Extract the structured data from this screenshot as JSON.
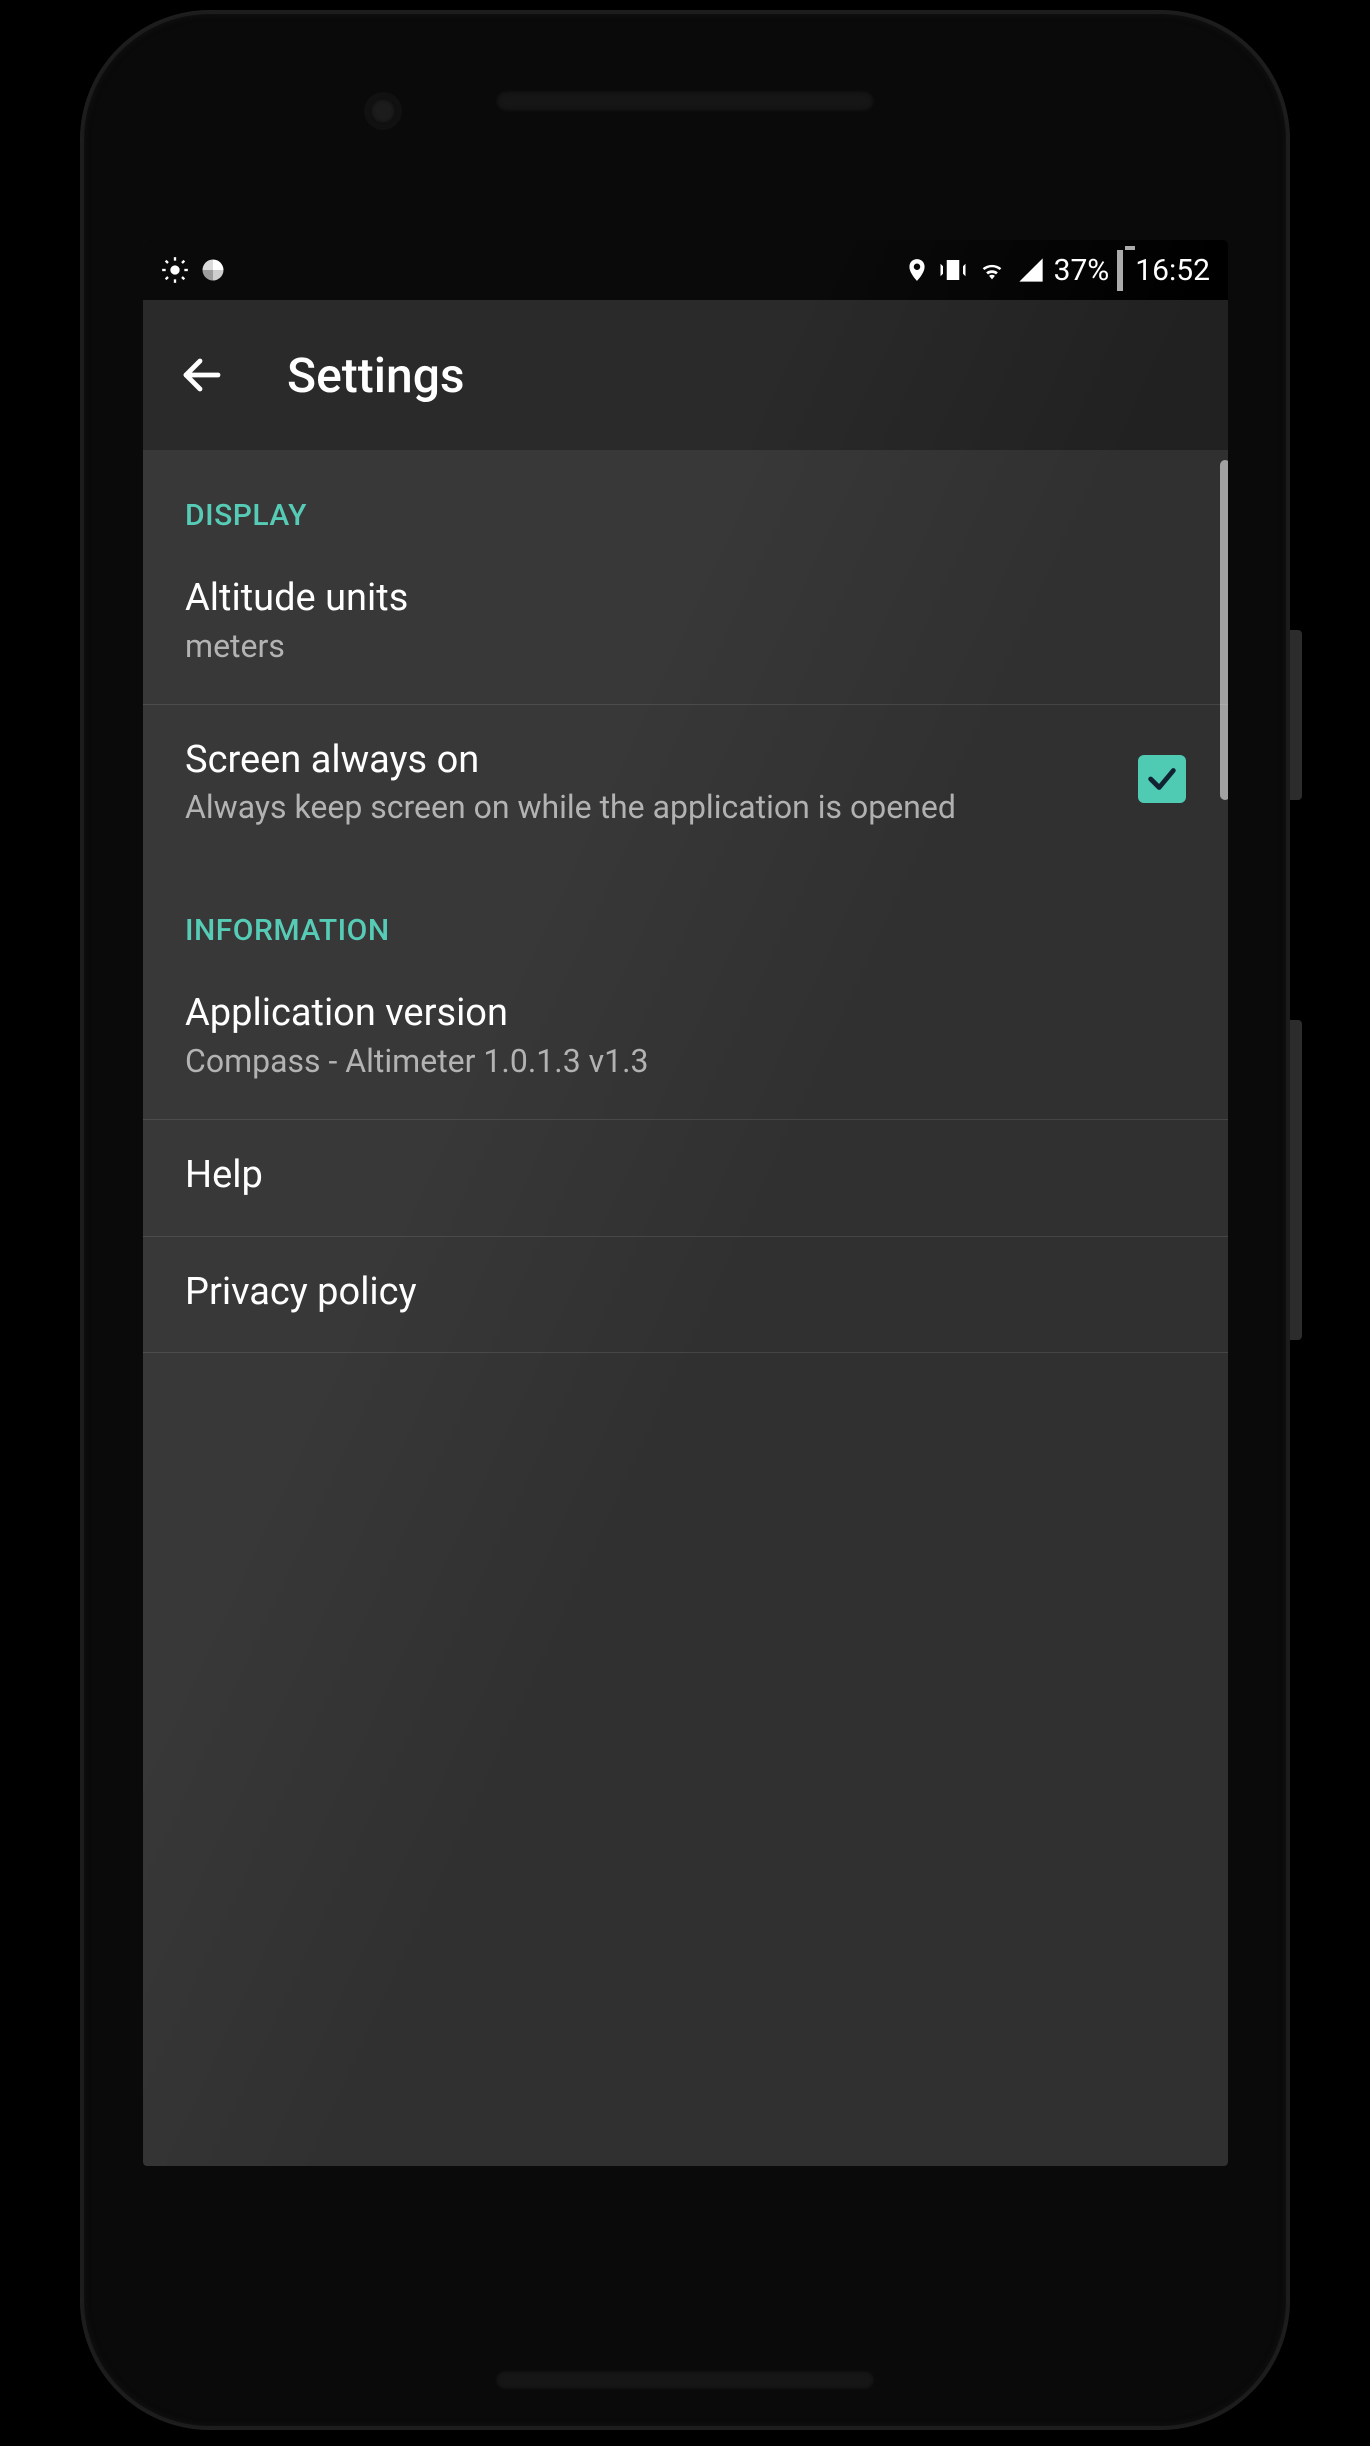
{
  "statusbar": {
    "battery_pct": "37%",
    "time": "16:52"
  },
  "appbar": {
    "title": "Settings"
  },
  "sections": {
    "display": {
      "label": "DISPLAY",
      "altitude_units": {
        "title": "Altitude units",
        "value": "meters"
      },
      "screen_on": {
        "title": "Screen always on",
        "sub": "Always keep screen on while the application is opened",
        "checked": true
      }
    },
    "information": {
      "label": "INFORMATION",
      "version": {
        "title": "Application version",
        "value": "Compass - Altimeter 1.0.1.3 v1.3"
      },
      "help": {
        "title": "Help"
      },
      "privacy": {
        "title": "Privacy policy"
      }
    }
  },
  "colors": {
    "accent": "#4fcab3"
  }
}
